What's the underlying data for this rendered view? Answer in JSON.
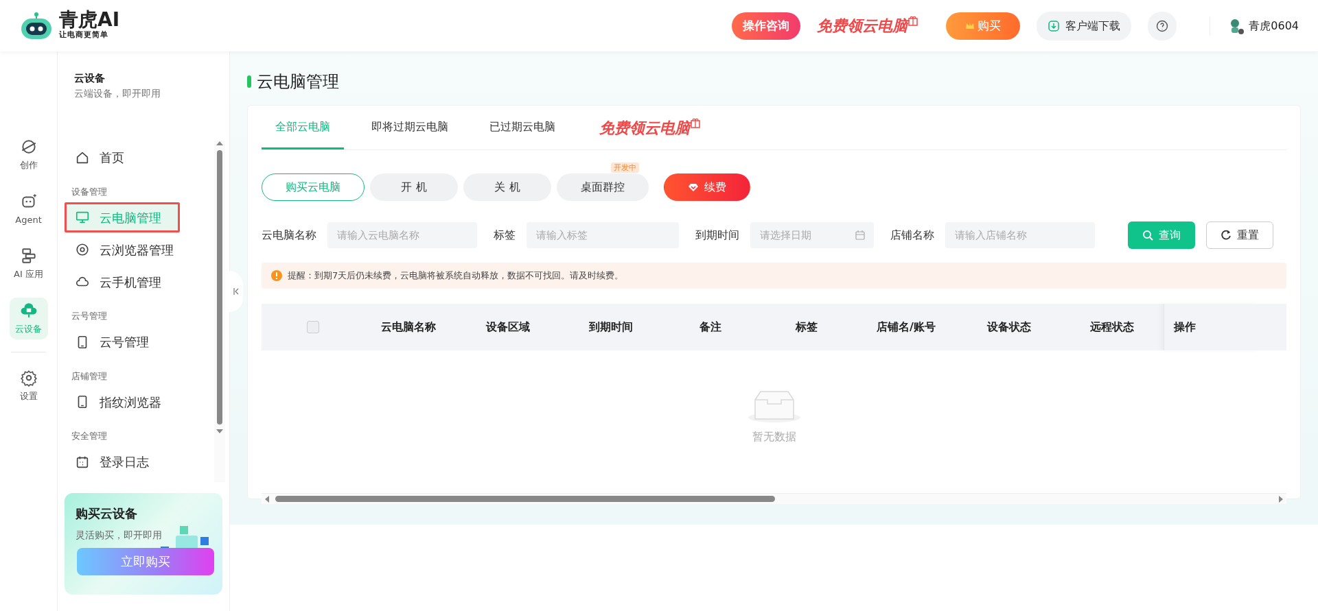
{
  "header": {
    "logo_title": "青虎AI",
    "logo_slogan": "让电商更简单",
    "consult": "操作咨询",
    "promo": "免费领云电脑",
    "buy": "购买",
    "download": "客户端下载",
    "user": "青虎0604"
  },
  "rail": [
    {
      "label": "创作",
      "selected": false
    },
    {
      "label": "Agent",
      "selected": false
    },
    {
      "label": "AI 应用",
      "selected": false
    },
    {
      "label": "云设备",
      "selected": true
    },
    {
      "label": "设置",
      "selected": false
    }
  ],
  "sidebar": {
    "title": "云设备",
    "subtitle": "云端设备，即开即用",
    "groups": [
      {
        "items": [
          {
            "label": "首页",
            "selected": false,
            "highlighted": false
          }
        ]
      },
      {
        "title": "设备管理",
        "items": [
          {
            "label": "云电脑管理",
            "selected": true,
            "highlighted": true
          },
          {
            "label": "云浏览器管理",
            "selected": false,
            "highlighted": false
          },
          {
            "label": "云手机管理",
            "selected": false,
            "highlighted": false
          }
        ]
      },
      {
        "title": "云号管理",
        "items": [
          {
            "label": "云号管理",
            "selected": false,
            "highlighted": false
          }
        ]
      },
      {
        "title": "店铺管理",
        "items": [
          {
            "label": "指纹浏览器",
            "selected": false,
            "highlighted": false
          }
        ]
      },
      {
        "title": "安全管理",
        "items": [
          {
            "label": "登录日志",
            "selected": false,
            "highlighted": false
          }
        ]
      }
    ],
    "promo": {
      "title": "购买云设备",
      "text": "灵活购买，即开即用",
      "button": "立即购买"
    }
  },
  "page": {
    "title": "云电脑管理",
    "tabs": [
      {
        "label": "全部云电脑",
        "selected": true
      },
      {
        "label": "即将过期云电脑",
        "selected": false
      },
      {
        "label": "已过期云电脑",
        "selected": false
      }
    ],
    "tab_promo": "免费领云电脑",
    "actions": [
      {
        "label": "购买云电脑",
        "kind": "outline"
      },
      {
        "label": "开 机",
        "kind": "plain"
      },
      {
        "label": "关 机",
        "kind": "plain"
      },
      {
        "label": "桌面群控",
        "kind": "plain",
        "badge": "开发中"
      },
      {
        "label": "续费",
        "kind": "danger"
      }
    ],
    "filters": [
      {
        "label": "云电脑名称",
        "placeholder": "请输入云电脑名称",
        "kind": "text"
      },
      {
        "label": "标签",
        "placeholder": "请输入标签",
        "kind": "text"
      },
      {
        "label": "到期时间",
        "placeholder": "请选择日期",
        "kind": "date"
      },
      {
        "label": "店铺名称",
        "placeholder": "请输入店铺名称",
        "kind": "text"
      }
    ],
    "search_button": "查询",
    "reset_button": "重置",
    "notice": "提醒：到期7天后仍未续费，云电脑将被系统自动释放，数据不可找回。请及时续费。",
    "table": {
      "select_all": false,
      "columns": [
        "云电脑名称",
        "设备区域",
        "到期时间",
        "备注",
        "标签",
        "店铺名/账号",
        "设备状态",
        "远程状态",
        "操作"
      ],
      "empty": "暂无数据"
    }
  }
}
